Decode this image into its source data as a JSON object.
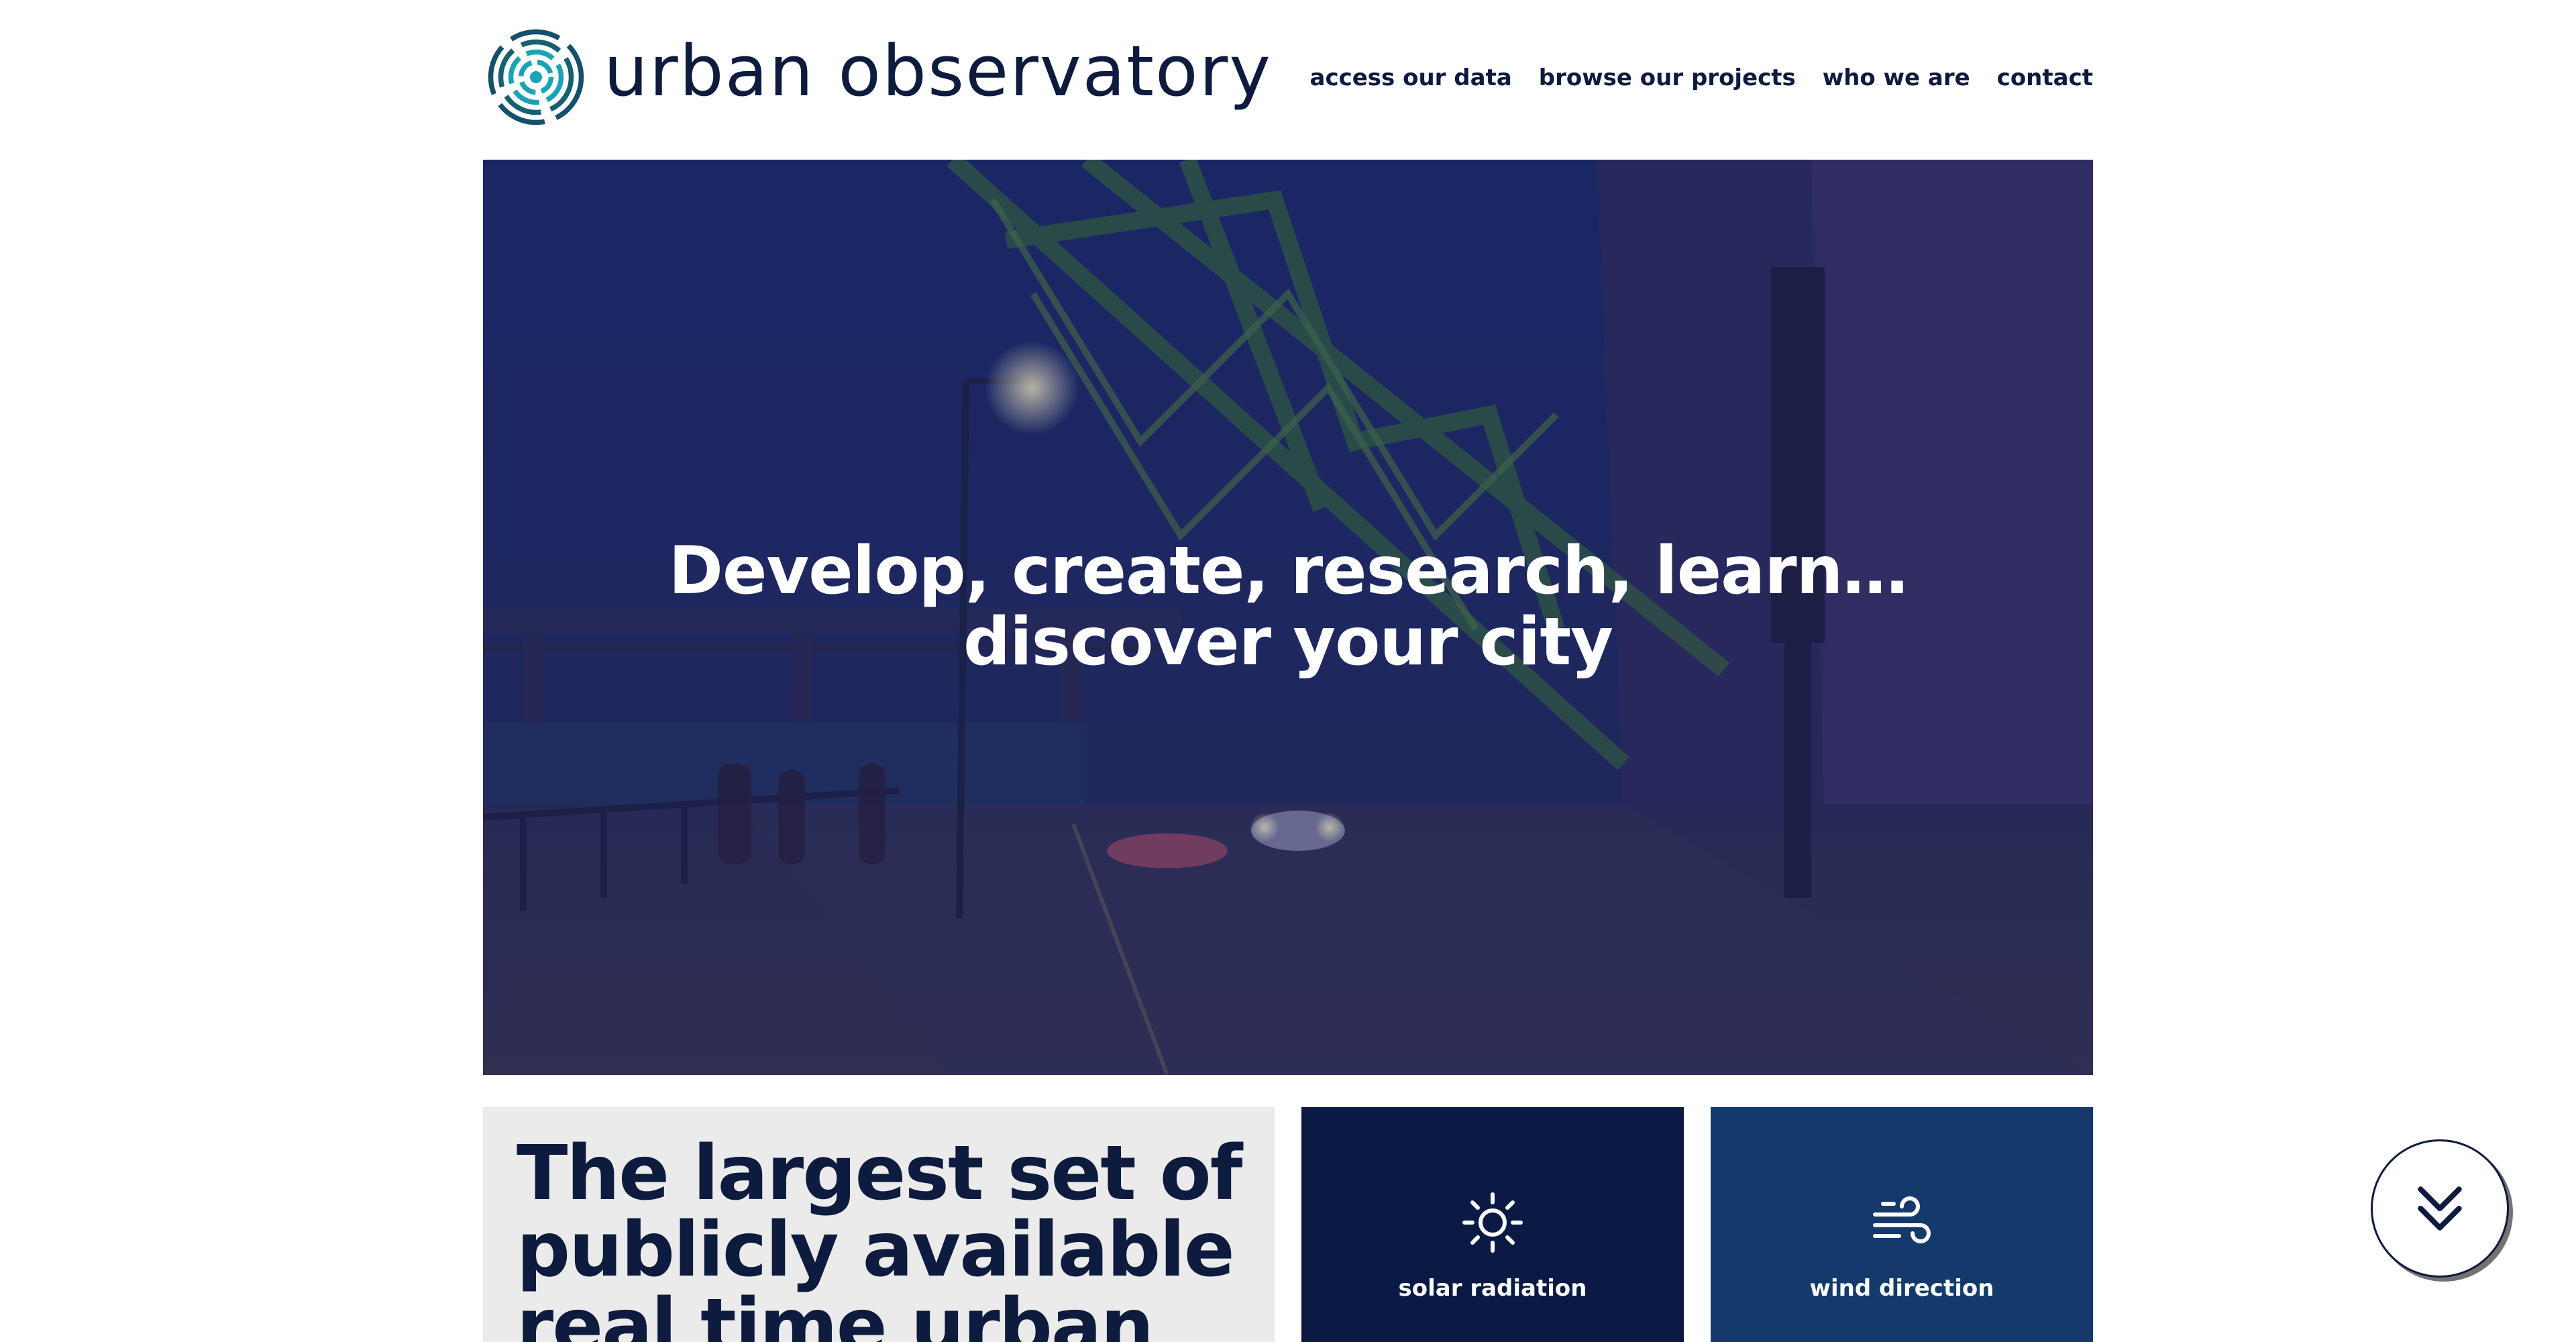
{
  "header": {
    "logo_text": "urban observatory",
    "nav": [
      {
        "label": "access our data"
      },
      {
        "label": "browse our projects"
      },
      {
        "label": "who we are"
      },
      {
        "label": "contact"
      }
    ]
  },
  "hero": {
    "line1": "Develop, create, research, learn…",
    "line2": "discover your city"
  },
  "intro": {
    "heading": "The largest set of publicly available real time urban"
  },
  "tiles": [
    {
      "label": "solar radiation",
      "icon": "sun-icon"
    },
    {
      "label": "wind direction",
      "icon": "wind-icon"
    }
  ],
  "scroll_button": {
    "icon": "double-chevron-down-icon"
  },
  "colors": {
    "navy": "#0d1b3e",
    "teal": "#1aa3b5",
    "solar_tile": "#0b1a45",
    "wind_tile": "#143a6b",
    "intro_bg": "#ebebeb"
  }
}
